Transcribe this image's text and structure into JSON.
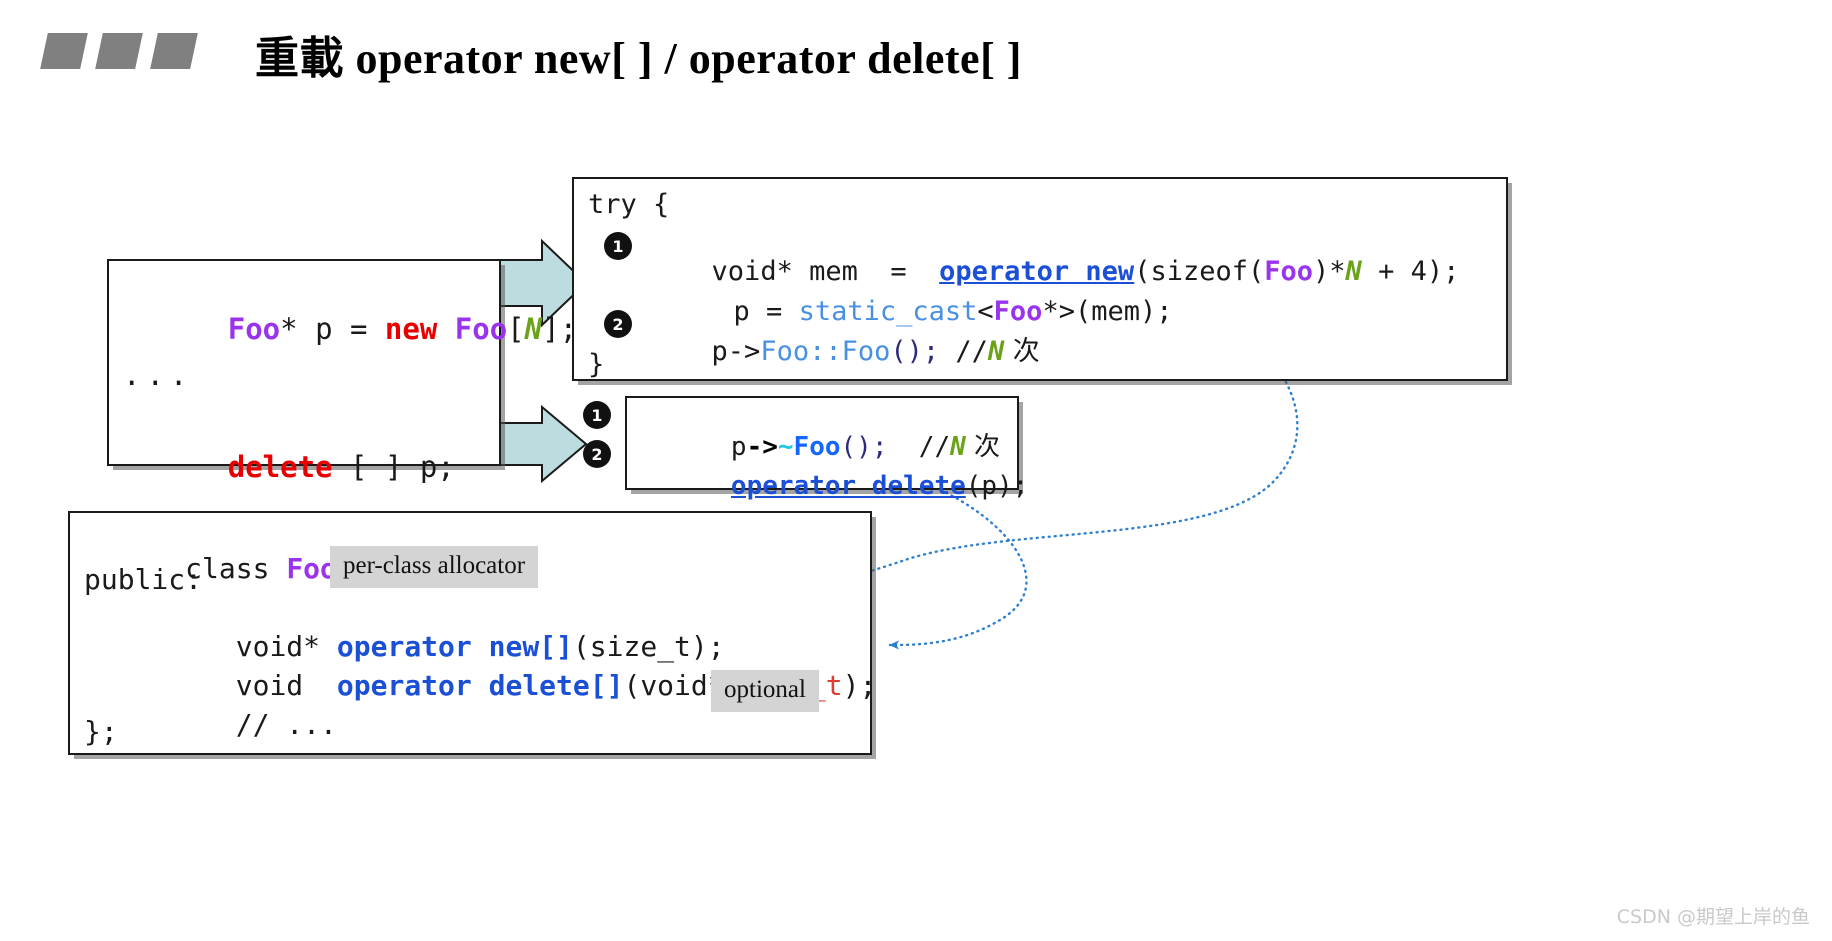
{
  "title": {
    "text": "重載 operator new[ ] / operator delete[ ]",
    "decoration": "three-parallelograms"
  },
  "left_code_box": {
    "name": "usage-snippet",
    "lines": [
      {
        "id": "alloc",
        "tokens": [
          {
            "text": "Foo",
            "color": "#9933ee"
          },
          {
            "text": "* p = ",
            "color": "#1a1a1a"
          },
          {
            "text": "new",
            "color": "#e60000"
          },
          {
            "text": " ",
            "color": "#1a1a1a"
          },
          {
            "text": "Foo",
            "color": "#9933ee"
          },
          {
            "text": "[",
            "color": "#1a1a1a"
          },
          {
            "text": "N",
            "color": "#6aa318"
          },
          {
            "text": "];",
            "color": "#1a1a1a"
          }
        ],
        "plain": "Foo* p = new Foo[N];"
      },
      {
        "id": "ellipsis",
        "plain": "..."
      },
      {
        "id": "dealloc",
        "tokens": [
          {
            "text": "delete",
            "color": "#e60000"
          },
          {
            "text": " [ ] p;",
            "color": "#1a1a1a"
          }
        ],
        "plain": "delete [ ] p;"
      }
    ]
  },
  "try_box": {
    "name": "new-expansion",
    "lines": [
      {
        "id": "try-open",
        "plain": "try {"
      },
      {
        "id": "operator-new-call",
        "badge": "1",
        "plain": "void* mem  =  operator new(sizeof(Foo)*N + 4);"
      },
      {
        "id": "static-cast",
        "plain": "p = static_cast<Foo*>(mem);"
      },
      {
        "id": "ctor-call",
        "badge": "2",
        "plain": "p->Foo::Foo(); //N 次"
      },
      {
        "id": "try-close",
        "plain": "}"
      }
    ],
    "parts": {
      "try_keyword": "try {",
      "void_star_mem": "void* mem  =  ",
      "operator_new": "operator new",
      "sizeof_open": "(sizeof(",
      "foo": "Foo",
      "times": ")*",
      "n": "N",
      "plus4": " + 4);",
      "p_assign": "p = ",
      "static_cast": "static_cast",
      "lt": "<",
      "star_gt_mem": "*>(mem);",
      "p_arrow": "p->",
      "foo_ctor": "Foo::Foo",
      "paren_semi": "();",
      "comment_slashes": " //",
      "comment_n": "N",
      "comment_cjk": " 次",
      "brace_close": "}"
    }
  },
  "delete_box": {
    "name": "delete-expansion",
    "lines": [
      {
        "id": "dtor-call",
        "badge": "1",
        "plain": "p->~Foo(); //N 次"
      },
      {
        "id": "operator-delete-call",
        "badge": "2",
        "plain": "operator delete(p);"
      }
    ],
    "parts": {
      "p": "p",
      "arrow": "->",
      "tilde": "~",
      "foo": "Foo",
      "paren_semi": "();",
      "comment_slashes": "  //",
      "comment_n": "N",
      "comment_cjk": " 次",
      "operator_delete": "operator delete",
      "arg_p": "(p);"
    }
  },
  "class_box": {
    "name": "class-foo-declaration",
    "lines": [
      {
        "id": "class-open",
        "plain": "class Foo {"
      },
      {
        "id": "public-label",
        "plain": "public:"
      },
      {
        "id": "decl-new-array",
        "plain": "void* operator new[](size_t);"
      },
      {
        "id": "decl-delete-array",
        "plain": "void  operator delete[](void*,size_t);"
      },
      {
        "id": "comment-more",
        "plain": "// ..."
      },
      {
        "id": "class-close",
        "plain": "};"
      }
    ],
    "parts": {
      "class_kw": "class ",
      "foo": "Foo",
      "brace": " {",
      "public": "public:",
      "void_star": "void* ",
      "operator_new_arr": "operator new[]",
      "size_t_arg": "(size_t);",
      "void_sp": "void  ",
      "operator_delete_arr": "operator delete[]",
      "void_star_comma": "(void*,",
      "size_t": "size_t",
      "close_semi": ");",
      "comment": "// ...",
      "class_end": "};"
    }
  },
  "callouts": [
    {
      "id": "per-class-allocator",
      "text": "per-class allocator"
    },
    {
      "id": "optional",
      "text": "optional"
    }
  ],
  "badges": {
    "try_1": "1",
    "try_2": "2",
    "delete_1": "1",
    "delete_2": "2"
  },
  "watermark": {
    "text": "CSDN @期望上岸的鱼"
  },
  "colors": {
    "purple": "#9933ee",
    "red": "#e60000",
    "green": "#6aa318",
    "blue": "#1a4fd6",
    "light_blue": "#4a90e2",
    "cyan": "#22c6e8",
    "arrow_fill": "#bcdcdf",
    "callout_bg": "#d4d4d4",
    "title_decoration": "#808080",
    "connector": "#2f7fd0",
    "watermark": "#c9c9c9"
  }
}
